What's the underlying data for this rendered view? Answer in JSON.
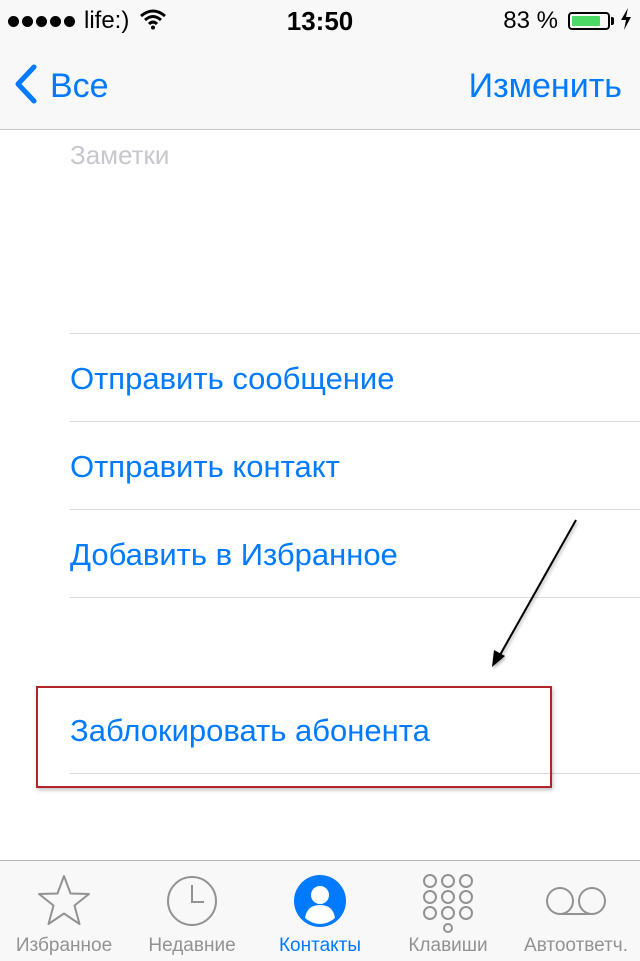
{
  "status_bar": {
    "carrier": "life:)",
    "time": "13:50",
    "battery_percent": "83 %",
    "battery_level": 0.83
  },
  "nav": {
    "back_label": "Все",
    "edit_label": "Изменить"
  },
  "notes": {
    "placeholder": "Заметки"
  },
  "actions": {
    "send_message": "Отправить сообщение",
    "share_contact": "Отправить контакт",
    "add_favorite": "Добавить в Избранное",
    "block_caller": "Заблокировать абонента"
  },
  "tabbar": {
    "tabs": [
      {
        "label": "Избранное",
        "icon": "star-icon"
      },
      {
        "label": "Недавние",
        "icon": "clock-icon"
      },
      {
        "label": "Контакты",
        "icon": "contacts-icon",
        "active": true
      },
      {
        "label": "Клавиши",
        "icon": "keypad-icon"
      },
      {
        "label": "Автоответч.",
        "icon": "voicemail-icon"
      }
    ]
  },
  "colors": {
    "accent": "#007aff",
    "highlight_border": "#b3242d",
    "tab_inactive": "#929292"
  }
}
